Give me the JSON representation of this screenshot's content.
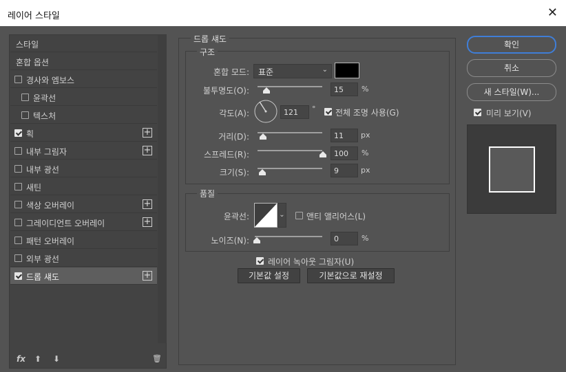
{
  "window": {
    "title": "레이어 스타일",
    "close": "✕"
  },
  "styles_list": {
    "items": [
      {
        "label": "스타일",
        "checkbox": null,
        "plus": false
      },
      {
        "label": "혼합 옵션",
        "checkbox": null,
        "plus": false
      },
      {
        "label": "경사와 엠보스",
        "checkbox": false,
        "plus": false
      },
      {
        "label": "윤곽선",
        "checkbox": false,
        "plus": false
      },
      {
        "label": "텍스처",
        "checkbox": false,
        "plus": false
      },
      {
        "label": "획",
        "checkbox": true,
        "plus": true
      },
      {
        "label": "내부 그림자",
        "checkbox": false,
        "plus": true
      },
      {
        "label": "내부 광선",
        "checkbox": false,
        "plus": false
      },
      {
        "label": "새틴",
        "checkbox": false,
        "plus": false
      },
      {
        "label": "색상 오버레이",
        "checkbox": false,
        "plus": true
      },
      {
        "label": "그레이디언트 오버레이",
        "checkbox": false,
        "plus": true
      },
      {
        "label": "패턴 오버레이",
        "checkbox": false,
        "plus": false
      },
      {
        "label": "외부 광선",
        "checkbox": false,
        "plus": false
      },
      {
        "label": "드롭 섀도",
        "checkbox": true,
        "plus": true,
        "active": true
      }
    ],
    "footer": {
      "fx": "fx",
      "up": "⬆",
      "down": "⬇",
      "trash": "🗑"
    }
  },
  "drop_shadow": {
    "section_title": "드롭 섀도",
    "structure": {
      "title": "구조",
      "blend_mode_label": "혼합 모드:",
      "blend_mode_value": "표준",
      "shadow_color": "#000000",
      "opacity_label": "불투명도(O):",
      "opacity_value": "15",
      "opacity_unit": "%",
      "angle_label": "각도(A):",
      "angle_value": "121",
      "angle_unit": "°",
      "global_light_label": "전체 조명 사용(G)",
      "global_light_checked": true,
      "distance_label": "거리(D):",
      "distance_value": "11",
      "distance_unit": "px",
      "spread_label": "스프레드(R):",
      "spread_value": "100",
      "spread_unit": "%",
      "size_label": "크기(S):",
      "size_value": "9",
      "size_unit": "px"
    },
    "quality": {
      "title": "품질",
      "contour_label": "윤곽선:",
      "anti_alias_label": "앤티 앨리어스(L)",
      "anti_alias_checked": false,
      "noise_label": "노이즈(N):",
      "noise_value": "0",
      "noise_unit": "%"
    },
    "knockout_label": "레이어 녹아웃 그림자(U)",
    "knockout_checked": true,
    "make_default_label": "기본값 설정",
    "reset_default_label": "기본값으로 재설정"
  },
  "buttons": {
    "ok": "확인",
    "cancel": "취소",
    "new_style": "새 스타일(W)...",
    "preview_label": "미리 보기(V)",
    "preview_checked": true
  },
  "colors": {
    "accent": "#3f7ed8"
  }
}
